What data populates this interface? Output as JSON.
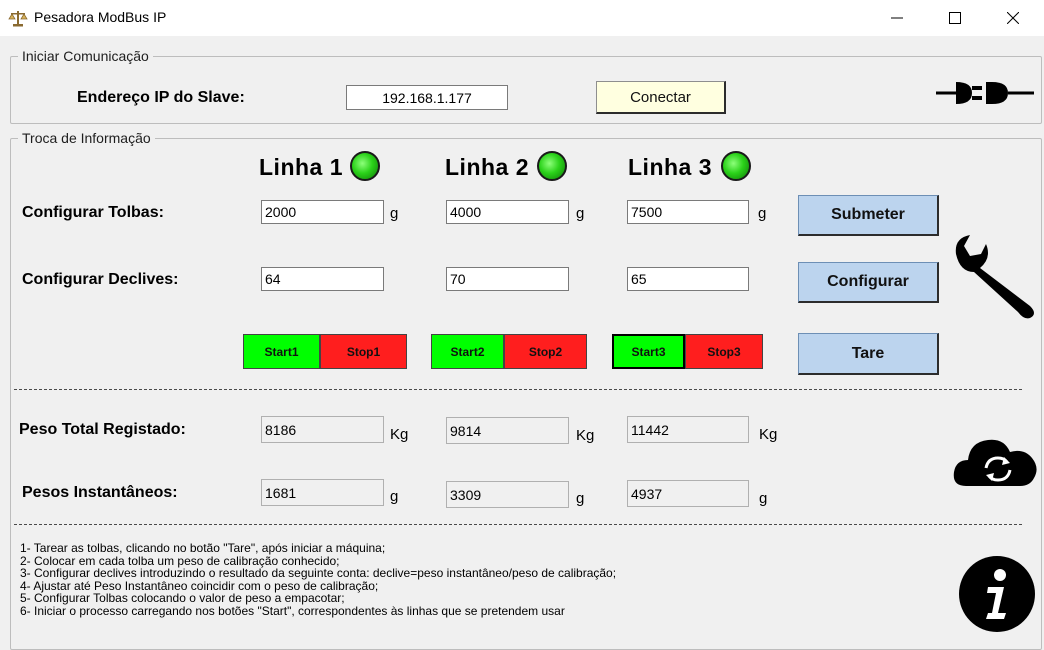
{
  "window": {
    "title": "Pesadora ModBus IP",
    "icons": [
      "scale-icon",
      "minimize-icon",
      "maximize-icon",
      "close-icon"
    ]
  },
  "comm": {
    "legend": "Iniciar Comunicação",
    "ip_label": "Endereço IP do Slave:",
    "ip_value": "192.168.1.177",
    "connect_label": "Conectar"
  },
  "exchange": {
    "legend": "Troca de Informação",
    "lines": [
      "Linha 1",
      "Linha 2",
      "Linha 3"
    ],
    "tolbas_label": "Configurar Tolbas:",
    "tolbas": [
      "2000",
      "4000",
      "7500"
    ],
    "tolbas_unit": "g",
    "declives_label": "Configurar Declives:",
    "declives": [
      "64",
      "70",
      "65"
    ],
    "submit_label": "Submeter",
    "configure_label": "Configurar",
    "tare_label": "Tare",
    "start_labels": [
      "Start1",
      "Start2",
      "Start3"
    ],
    "stop_labels": [
      "Stop1",
      "Stop2",
      "Stop3"
    ],
    "peso_total_label": "Peso Total Registado:",
    "peso_total": [
      "8186",
      "9814",
      "11442"
    ],
    "peso_total_unit": "Kg",
    "pesos_inst_label": "Pesos Instantâneos:",
    "pesos_inst": [
      "1681",
      "3309",
      "4937"
    ],
    "pesos_inst_unit": "g"
  },
  "instructions": [
    "1- Tarear as tolbas, clicando no botão \"Tare\", após iniciar a máquina;",
    "2- Colocar em cada tolba um peso de calibração conhecido;",
    "3- Configurar declives introduzindo o resultado da seguinte conta: declive=peso instantâneo/peso de calibração;",
    "4- Ajustar até Peso Instantâneo coincidir com o peso de calibração;",
    "5- Configurar Tolbas colocando o valor de peso a empacotar;",
    "6- Iniciar o processo carregando nos botões \"Start\", correspondentes às linhas que se pretendem usar"
  ],
  "colors": {
    "button_blue": "#bcd4ee",
    "start_green": "#00ff00",
    "stop_red": "#ff1e1e",
    "led_green": "#2bd21a",
    "connect_yellow": "#ffffe0"
  }
}
